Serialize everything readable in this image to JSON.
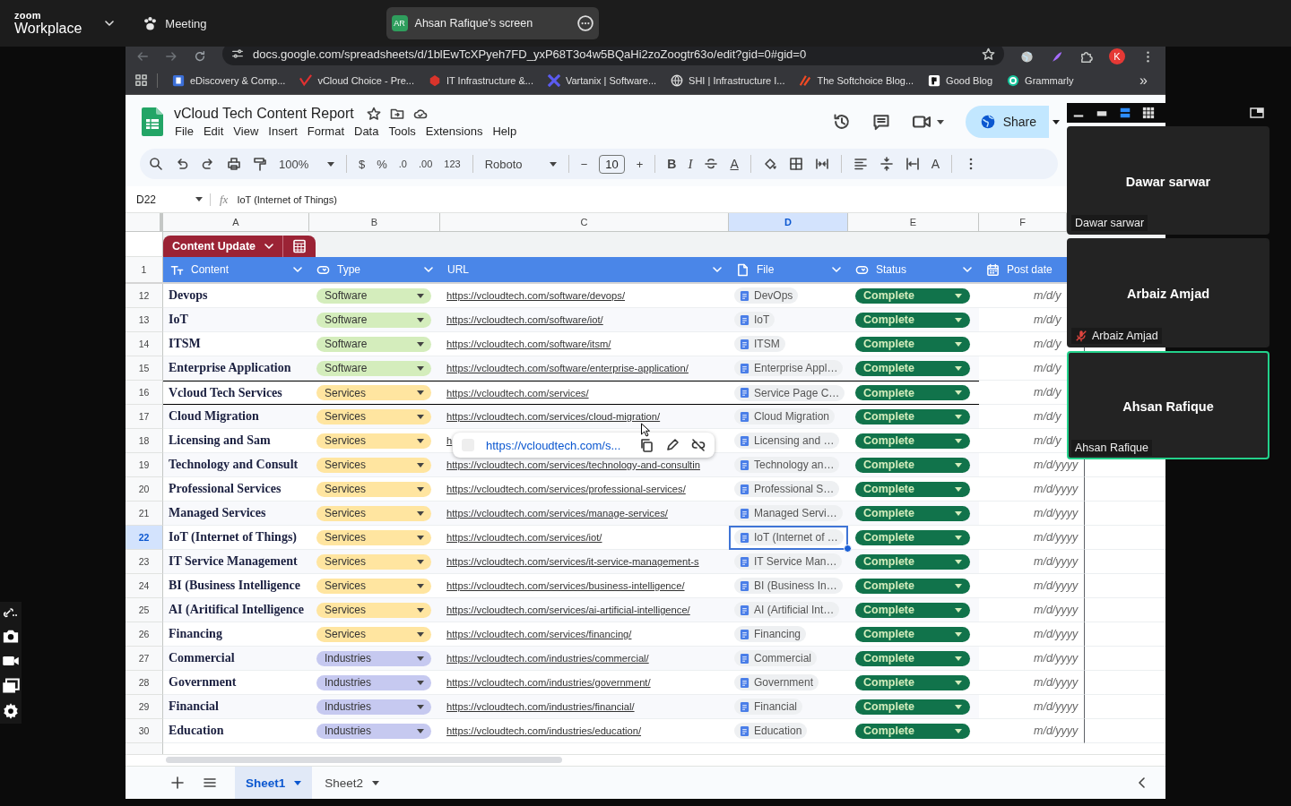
{
  "zoom_bar": {
    "logo_top": "zoom",
    "logo_bottom": "Workplace",
    "meeting": "Meeting",
    "share_tab": {
      "initials": "AR",
      "title": "Ahsan Rafique's screen"
    }
  },
  "browser": {
    "url": "docs.google.com/spreadsheets/d/1blEwTcXPyeh7FD_yxP68T3o4w5BQaHi2zoZoogtr63o/edit?gid=0#gid=0",
    "profile": "K",
    "more": "»",
    "bookmarks": [
      {
        "label": "eDiscovery & Comp..."
      },
      {
        "label": "vCloud Choice - Pre..."
      },
      {
        "label": "IT Infrastructure &..."
      },
      {
        "label": "Vartanix | Software..."
      },
      {
        "label": "SHI | Infrastructure I..."
      },
      {
        "label": "The Softchoice Blog..."
      },
      {
        "label": "Good Blog"
      },
      {
        "label": "Grammarly"
      }
    ]
  },
  "sheets": {
    "title": "vCloud Tech Content Report",
    "menu": [
      "File",
      "Edit",
      "View",
      "Insert",
      "Format",
      "Data",
      "Tools",
      "Extensions",
      "Help"
    ],
    "share": "Share",
    "toolbar": {
      "zoom": "100%",
      "currency": "$",
      "percent": "%",
      "decimal_less": ".0",
      "decimal_more": ".00",
      "number_format": "123",
      "font": "Roboto",
      "font_size": "10",
      "minus": "−",
      "plus": "+",
      "bold": "B",
      "italic": "I",
      "text_color": "A",
      "text_rotation": "A"
    },
    "name_box": "D22",
    "fx": "fx",
    "formula": "IoT (Internet of Things)",
    "columns": [
      {
        "letter": "A",
        "selected": false
      },
      {
        "letter": "B",
        "selected": false
      },
      {
        "letter": "C",
        "selected": false
      },
      {
        "letter": "D",
        "selected": true
      },
      {
        "letter": "E",
        "selected": false
      },
      {
        "letter": "F",
        "selected": false
      }
    ],
    "table_name": "Content Update",
    "header_row_number": "1",
    "headers": [
      {
        "label": "Content",
        "kind": "text"
      },
      {
        "label": "Type",
        "kind": "dropdown"
      },
      {
        "label": "URL",
        "kind": "plain"
      },
      {
        "label": "File",
        "kind": "file"
      },
      {
        "label": "Status",
        "kind": "dropdown"
      },
      {
        "label": "Post date",
        "kind": "date"
      }
    ],
    "rows": [
      {
        "number": "12",
        "content": "Devops",
        "type": {
          "label": "Software",
          "color": "#d4edbc"
        },
        "url": "https://vcloudtech.com/software/devops/",
        "file": "DevOps",
        "status": {
          "label": "Complete",
          "color": "#11734b"
        },
        "date": "m/d/y",
        "selected": false,
        "boxed": false
      },
      {
        "number": "13",
        "content": "IoT",
        "type": {
          "label": "Software",
          "color": "#d4edbc"
        },
        "url": "https://vcloudtech.com/software/iot/",
        "file": "IoT",
        "status": {
          "label": "Complete",
          "color": "#11734b"
        },
        "date": "m/d/y",
        "selected": false,
        "boxed": false
      },
      {
        "number": "14",
        "content": "ITSM",
        "type": {
          "label": "Software",
          "color": "#d4edbc"
        },
        "url": "https://vcloudtech.com/software/itsm/",
        "file": "ITSM",
        "status": {
          "label": "Complete",
          "color": "#11734b"
        },
        "date": "m/d/y",
        "selected": false,
        "boxed": false
      },
      {
        "number": "15",
        "content": "Enterprise Application",
        "type": {
          "label": "Software",
          "color": "#d4edbc"
        },
        "url": "https://vcloudtech.com/software/enterprise-application/",
        "file": "Enterprise Appl…",
        "status": {
          "label": "Complete",
          "color": "#11734b"
        },
        "date": "m/d/y",
        "selected": false,
        "boxed": false
      },
      {
        "number": "16",
        "content": "Vcloud Tech Services",
        "type": {
          "label": "Services",
          "color": "#ffe5a0"
        },
        "url": "https://vcloudtech.com/services/",
        "file": "Service Page C…",
        "status": {
          "label": "Complete",
          "color": "#11734b"
        },
        "date": "m/d/y",
        "selected": false,
        "boxed": true
      },
      {
        "number": "17",
        "content": "Cloud Migration",
        "type": {
          "label": "Services",
          "color": "#ffe5a0"
        },
        "url": "https://vcloudtech.com/services/cloud-migration/",
        "file": "Cloud Migration",
        "status": {
          "label": "Complete",
          "color": "#11734b"
        },
        "date": "m/d/y",
        "selected": false,
        "boxed": false
      },
      {
        "number": "18",
        "content": "Licensing and Sam",
        "type": {
          "label": "Services",
          "color": "#ffe5a0"
        },
        "url": "h",
        "file": "Licensing and …",
        "status": {
          "label": "Complete",
          "color": "#11734b"
        },
        "date": "m/d/y",
        "selected": false,
        "boxed": false
      },
      {
        "number": "19",
        "content": "Technology and Consult",
        "type": {
          "label": "Services",
          "color": "#ffe5a0"
        },
        "url": "https://vcloudtech.com/services/technology-and-consultin",
        "file": "Technology an…",
        "status": {
          "label": "Complete",
          "color": "#11734b"
        },
        "date": "m/d/yyyy",
        "selected": false,
        "boxed": false
      },
      {
        "number": "20",
        "content": "Professional Services",
        "type": {
          "label": "Services",
          "color": "#ffe5a0"
        },
        "url": "https://vcloudtech.com/services/professional-services/",
        "file": "Professional S…",
        "status": {
          "label": "Complete",
          "color": "#11734b"
        },
        "date": "m/d/yyyy",
        "selected": false,
        "boxed": false
      },
      {
        "number": "21",
        "content": "Managed Services",
        "type": {
          "label": "Services",
          "color": "#ffe5a0"
        },
        "url": "https://vcloudtech.com/services/manage-services/",
        "file": "Managed Servi…",
        "status": {
          "label": "Complete",
          "color": "#11734b"
        },
        "date": "m/d/yyyy",
        "selected": false,
        "boxed": false
      },
      {
        "number": "22",
        "content": "IoT (Internet of Things)",
        "type": {
          "label": "Services",
          "color": "#ffe5a0"
        },
        "url": "https://vcloudtech.com/services/iot/",
        "file": "IoT (Internet of …",
        "status": {
          "label": "Complete",
          "color": "#11734b"
        },
        "date": "m/d/yyyy",
        "selected": true,
        "boxed": false
      },
      {
        "number": "23",
        "content": "IT Service Management",
        "type": {
          "label": "Services",
          "color": "#ffe5a0"
        },
        "url": "https://vcloudtech.com/services/it-service-management-s",
        "file": "IT Service Man…",
        "status": {
          "label": "Complete",
          "color": "#11734b"
        },
        "date": "m/d/yyyy",
        "selected": false,
        "boxed": false
      },
      {
        "number": "24",
        "content": "BI (Business Intelligence",
        "type": {
          "label": "Services",
          "color": "#ffe5a0"
        },
        "url": "https://vcloudtech.com/services/business-intelligence/",
        "file": "BI  (Business In…",
        "status": {
          "label": "Complete",
          "color": "#11734b"
        },
        "date": "m/d/yyyy",
        "selected": false,
        "boxed": false
      },
      {
        "number": "25",
        "content": "AI (Aritifical Intelligence",
        "type": {
          "label": "Services",
          "color": "#ffe5a0"
        },
        "url": "https://vcloudtech.com/services/ai-artificial-intelligence/",
        "file": "AI  (Artificial Int…",
        "status": {
          "label": "Complete",
          "color": "#11734b"
        },
        "date": "m/d/yyyy",
        "selected": false,
        "boxed": false
      },
      {
        "number": "26",
        "content": "Financing",
        "type": {
          "label": "Services",
          "color": "#ffe5a0"
        },
        "url": "https://vcloudtech.com/services/financing/",
        "file": "Financing",
        "status": {
          "label": "Complete",
          "color": "#11734b"
        },
        "date": "m/d/yyyy",
        "selected": false,
        "boxed": false
      },
      {
        "number": "27",
        "content": "Commercial",
        "type": {
          "label": "Industries",
          "color": "#c6c9f0"
        },
        "url": "https://vcloudtech.com/industries/commercial/",
        "file": "Commercial",
        "status": {
          "label": "Complete",
          "color": "#11734b"
        },
        "date": "m/d/yyyy",
        "selected": false,
        "boxed": false
      },
      {
        "number": "28",
        "content": "Government",
        "type": {
          "label": "Industries",
          "color": "#c6c9f0"
        },
        "url": "https://vcloudtech.com/industries/government/",
        "file": "Government",
        "status": {
          "label": "Complete",
          "color": "#11734b"
        },
        "date": "m/d/yyyy",
        "selected": false,
        "boxed": false
      },
      {
        "number": "29",
        "content": "Financial",
        "type": {
          "label": "Industries",
          "color": "#c6c9f0"
        },
        "url": "https://vcloudtech.com/industries/financial/",
        "file": "Financial",
        "status": {
          "label": "Complete",
          "color": "#11734b"
        },
        "date": "m/d/yyyy",
        "selected": false,
        "boxed": false
      },
      {
        "number": "30",
        "content": "Education",
        "type": {
          "label": "Industries",
          "color": "#c6c9f0"
        },
        "url": "https://vcloudtech.com/industries/education/",
        "file": "Education",
        "status": {
          "label": "Complete",
          "color": "#11734b"
        },
        "date": "m/d/yyyy",
        "selected": false,
        "boxed": false
      }
    ],
    "link_popover": {
      "url": "https://vcloudtech.com/s..."
    },
    "sheet_tabs": [
      {
        "label": "Sheet1",
        "selected": true
      },
      {
        "label": "Sheet2",
        "selected": false
      }
    ]
  },
  "participants": [
    {
      "name": "Dawar sarwar",
      "label": "Dawar sarwar",
      "muted": false,
      "speaking": false
    },
    {
      "name": "Arbaiz Amjad",
      "label": "Arbaiz Amjad",
      "muted": true,
      "speaking": false
    },
    {
      "name": "Ahsan Rafique",
      "label": "Ahsan Rafique",
      "muted": false,
      "speaking": true
    }
  ]
}
